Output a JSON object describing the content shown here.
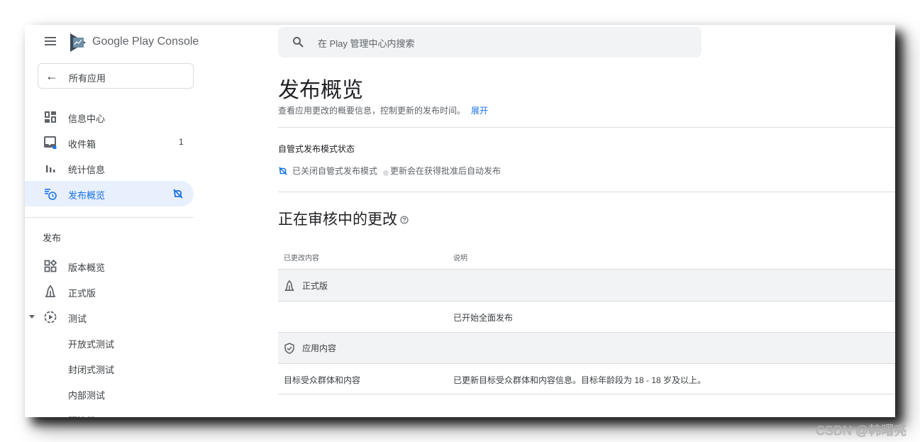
{
  "app": {
    "brand_primary": "Google Play",
    "brand_secondary": "Console",
    "accent_color": "#1a73e8"
  },
  "sidebar": {
    "back_label": "所有应用",
    "items": [
      {
        "label": "信息中心",
        "icon": "dashboard-icon"
      },
      {
        "label": "收件箱",
        "icon": "inbox-icon",
        "badge": "1"
      },
      {
        "label": "统计信息",
        "icon": "bar-chart-icon"
      },
      {
        "label": "发布概览",
        "icon": "publishing-overview-icon",
        "active": true,
        "trailing_icon": "managed-publishing-off-icon"
      }
    ],
    "section_label": "发布",
    "release_items": [
      {
        "label": "版本概览",
        "icon": "releases-overview-icon"
      },
      {
        "label": "正式版",
        "icon": "production-icon"
      },
      {
        "label": "测试",
        "icon": "testing-icon",
        "expanded": true
      }
    ],
    "testing_subitems": [
      {
        "label": "开放式测试"
      },
      {
        "label": "封闭式测试"
      },
      {
        "label": "内部测试"
      },
      {
        "label": "预注册"
      }
    ]
  },
  "search": {
    "placeholder": "在 Play 管理中心内搜索",
    "value": ""
  },
  "main": {
    "title": "发布概览",
    "description": "查看应用更改的概要信息，控制更新的发布时间。",
    "expand_link": "展开",
    "managed_publishing": {
      "title": "自管式发布模式状态",
      "status": "已关闭自管式发布模式",
      "note": "更新会在获得批准后自动发布"
    },
    "review_section": {
      "title": "正在审核中的更改",
      "columns": [
        "已更改内容",
        "说明"
      ],
      "groups": [
        {
          "label": "正式版",
          "icon": "production-icon",
          "rows": [
            {
              "item": "",
              "description": "已开始全面发布"
            }
          ]
        },
        {
          "label": "应用内容",
          "icon": "shield-check-icon",
          "rows": [
            {
              "item": "目标受众群体和内容",
              "description": "已更新目标受众群体和内容信息。目标年龄段为 18 - 18 岁及以上。"
            }
          ]
        }
      ]
    }
  },
  "watermark": "CSDN @韩曙亮"
}
